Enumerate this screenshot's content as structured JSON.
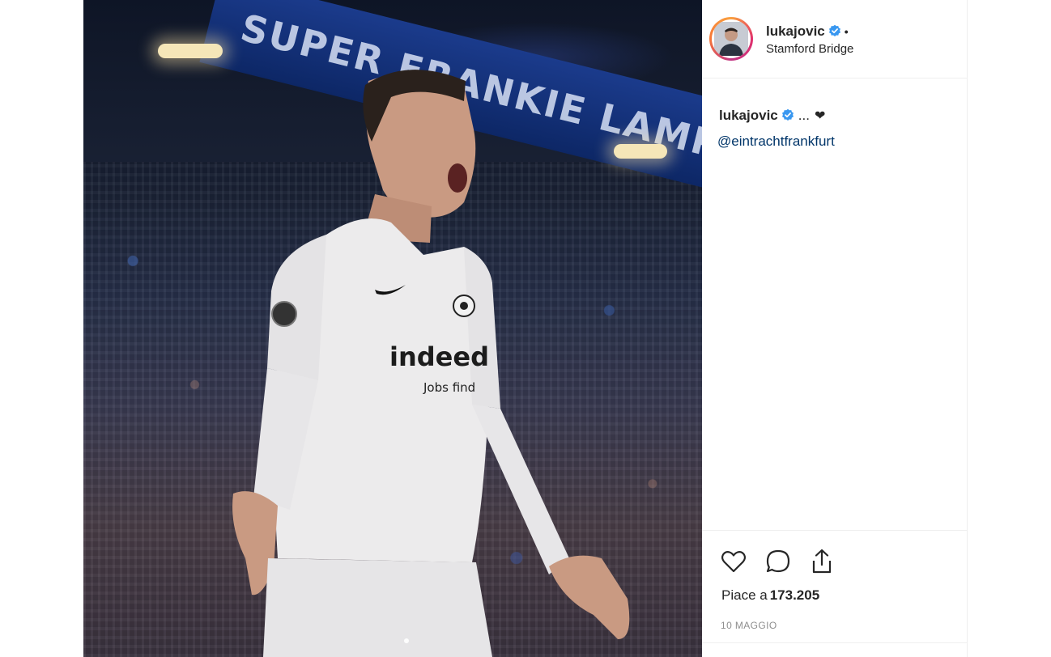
{
  "post": {
    "username": "lukajovic",
    "location": "Stamford Bridge",
    "header_dot": "•",
    "caption": {
      "username": "lukajovic",
      "text": "...",
      "emoji": "❤"
    },
    "mention": "@eintrachtfrankfurt",
    "likes_label": "Piace a",
    "likes_count": "173.205",
    "date": "10 MAGGIO"
  },
  "photo": {
    "banner_text": "SUPER FRANKIE LAMPARD",
    "shirt_sponsor": "indeed",
    "shirt_tagline": "Jobs find"
  },
  "icons": {
    "verified": "verified-badge-icon",
    "like": "heart-outline-icon",
    "comment": "comment-bubble-icon",
    "share": "share-upload-icon"
  },
  "colors": {
    "verified_blue": "#3897f0",
    "link_blue": "#003569",
    "text": "#262626",
    "muted": "#8e8e8e",
    "border": "#efefef"
  }
}
